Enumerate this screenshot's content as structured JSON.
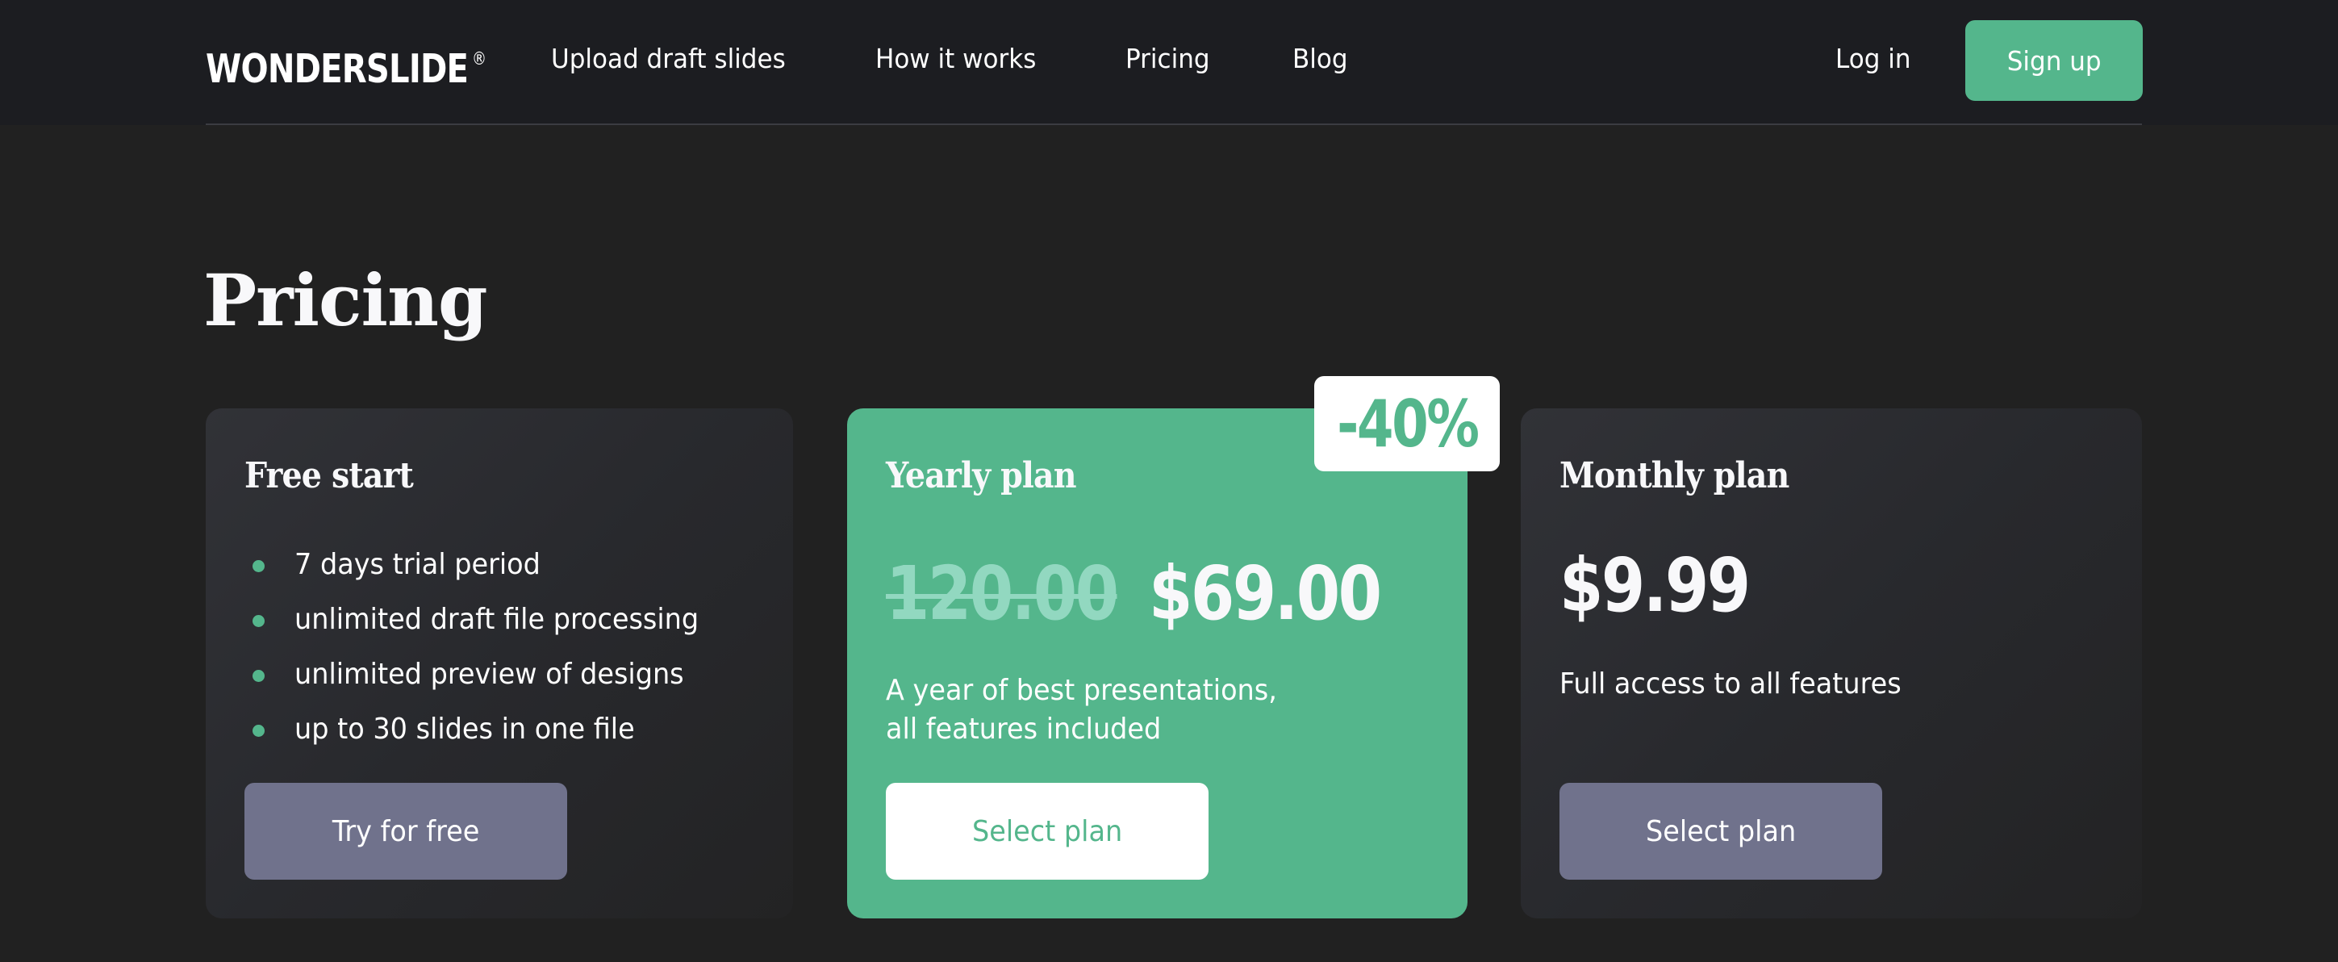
{
  "header": {
    "logo": "WONDERSLIDE",
    "logo_mark": "®",
    "nav": [
      {
        "label": "Upload draft slides"
      },
      {
        "label": "How it works"
      },
      {
        "label": "Pricing"
      },
      {
        "label": "Blog"
      }
    ],
    "login_label": "Log in",
    "signup_label": "Sign up"
  },
  "page": {
    "title": "Pricing"
  },
  "plans": [
    {
      "title": "Free start",
      "features": [
        "7 days trial period",
        "unlimited draft file processing",
        "unlimited preview of designs",
        "up to 30 slides in one file"
      ],
      "button_label": "Try for free"
    },
    {
      "title": "Yearly plan",
      "old_price": "120.00",
      "price": "$69.00",
      "description_lines": [
        "A year of best presentations,",
        "all features included"
      ],
      "badge": "-40%",
      "button_label": "Select plan"
    },
    {
      "title": "Monthly plan",
      "price": "$9.99",
      "description": "Full access to all features",
      "button_label": "Select plan"
    }
  ],
  "colors": {
    "accent": "#54b68c",
    "header_bg": "#1c1d21",
    "page_bg": "#212121",
    "muted_button": "#70728c",
    "old_price": "#92d8c0"
  }
}
